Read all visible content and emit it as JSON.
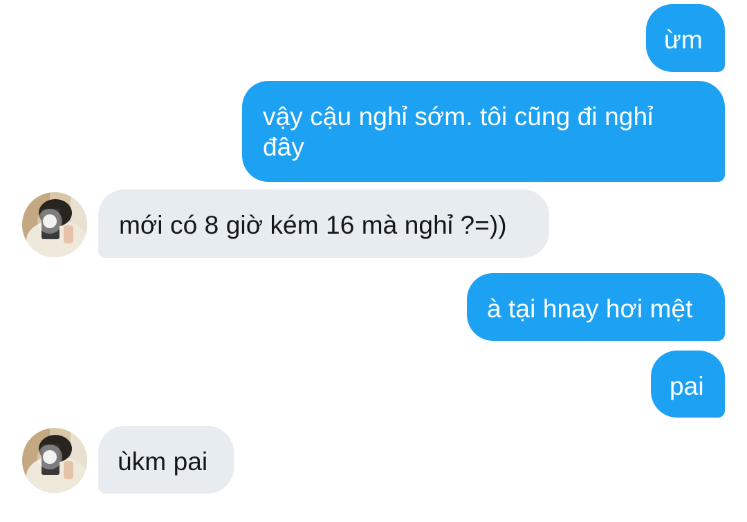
{
  "colors": {
    "sent_bubble": "#1da1f2",
    "received_bubble": "#e6ecf0",
    "sent_text": "#ffffff",
    "received_text": "#14171a"
  },
  "messages": [
    {
      "direction": "sent",
      "text": "ừm"
    },
    {
      "direction": "sent",
      "text": "vậy cậu nghỉ sớm. tôi cũng đi nghỉ\nđây"
    },
    {
      "direction": "received",
      "text": "mới có 8 giờ kém 16 mà nghỉ ?=))",
      "avatar": "contact-avatar"
    },
    {
      "direction": "sent",
      "text": "à tại hnay hơi mệt"
    },
    {
      "direction": "sent",
      "text": "pai"
    },
    {
      "direction": "received",
      "text": "ùkm pai",
      "avatar": "contact-avatar"
    }
  ]
}
